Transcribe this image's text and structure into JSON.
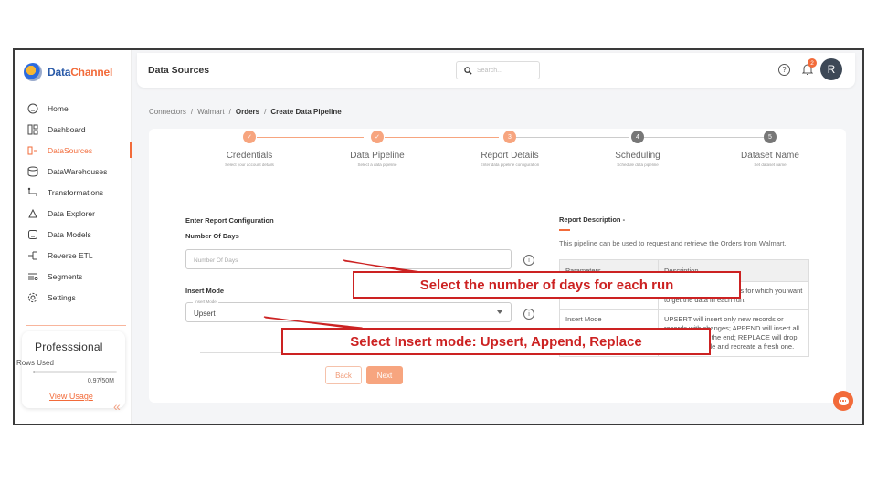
{
  "app": {
    "logo_text_primary": "Data",
    "logo_text_accent": "Channel",
    "brand_color": "#f26b3a"
  },
  "header": {
    "title": "Data Sources",
    "search_placeholder": "Search...",
    "notification_count": "2",
    "avatar_initial": "R"
  },
  "sidebar": {
    "items": [
      {
        "label": "Home",
        "icon": "home-icon",
        "active": false
      },
      {
        "label": "Dashboard",
        "icon": "dashboard-icon",
        "active": false
      },
      {
        "label": "DataSources",
        "icon": "datasources-icon",
        "active": true
      },
      {
        "label": "DataWarehouses",
        "icon": "database-icon",
        "active": false
      },
      {
        "label": "Transformations",
        "icon": "transform-icon",
        "active": false
      },
      {
        "label": "Data Explorer",
        "icon": "explorer-icon",
        "active": false
      },
      {
        "label": "Data Models",
        "icon": "models-icon",
        "active": false
      },
      {
        "label": "Reverse ETL",
        "icon": "reverse-etl-icon",
        "active": false
      },
      {
        "label": "Segments",
        "icon": "segments-icon",
        "active": false
      },
      {
        "label": "Settings",
        "icon": "settings-icon",
        "active": false
      }
    ],
    "plan": {
      "name": "Professsional",
      "rows_used_label": "Rows Used",
      "usage_value": "0.97/50M",
      "usage_fraction": 0.02,
      "view_usage": "View Usage"
    }
  },
  "breadcrumb": [
    "Connectors",
    "Walmart",
    "Orders",
    "Create Data Pipeline"
  ],
  "stepper": [
    {
      "number": "1",
      "title": "Credentials",
      "subtitle": "Select your account details",
      "state": "done"
    },
    {
      "number": "2",
      "title": "Data Pipeline",
      "subtitle": "Select a data pipeline",
      "state": "done"
    },
    {
      "number": "3",
      "title": "Report Details",
      "subtitle": "Enter data pipeline configuration",
      "state": "current"
    },
    {
      "number": "4",
      "title": "Scheduling",
      "subtitle": "Schedule data pipeline",
      "state": "todo"
    },
    {
      "number": "5",
      "title": "Dataset Name",
      "subtitle": "Set dataset name",
      "state": "todo"
    }
  ],
  "form": {
    "section_title": "Enter Report Configuration",
    "days_label": "Number Of Days",
    "days_placeholder": "Number Of Days",
    "insert_label": "Insert Mode",
    "insert_float_label": "Insert Mode",
    "insert_value": "Upsert",
    "back": "Back",
    "next": "Next"
  },
  "description": {
    "title": "Report Description -",
    "text": "This pipeline can be used to request and retrieve the Orders from Walmart.",
    "table_headers": [
      "Parameters",
      "Description"
    ],
    "rows": [
      {
        "param": "Number Of Days",
        "desc": "Select the number of days for which you want to get the data in each run."
      },
      {
        "param": "Insert Mode",
        "desc": "UPSERT will insert only new records or records with changes; APPEND will insert all fetched data at the end; REPLACE will drop the existing table and recreate a fresh one."
      }
    ]
  },
  "annotations": {
    "days_callout": "Select the number of days for each run",
    "insert_callout": "Select Insert mode: Upsert, Append, Replace"
  }
}
